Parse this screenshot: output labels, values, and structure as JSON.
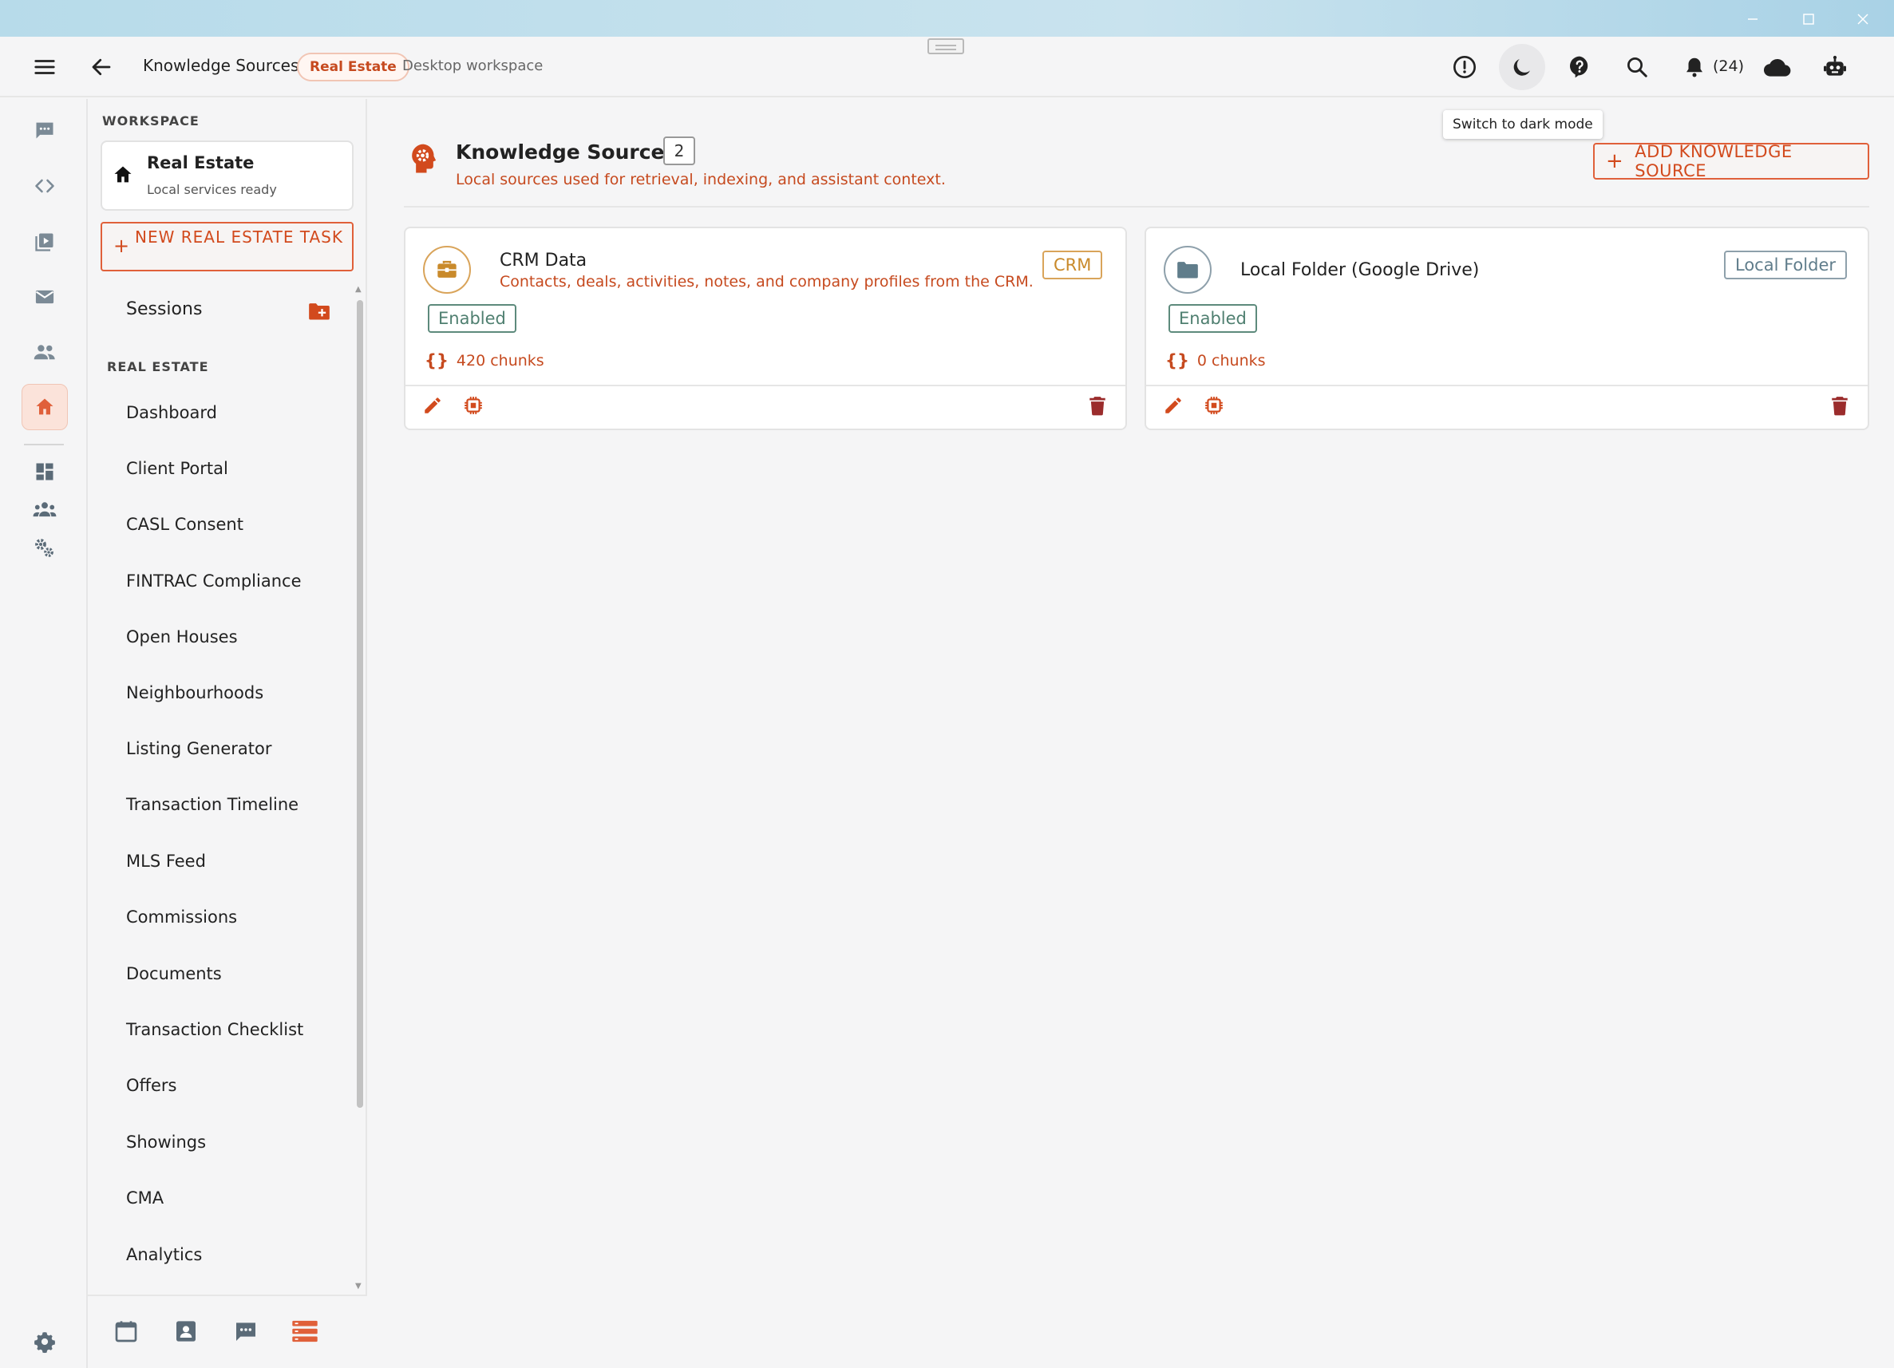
{
  "app": {
    "breadcrumb_title": "Knowledge Sources",
    "breadcrumb_pill": "Real Estate",
    "breadcrumb_sub": "Desktop workspace",
    "notification_count": "(24)",
    "tooltip": "Switch to dark mode"
  },
  "colors": {
    "accent": "#d24a1d",
    "accent_soft": "#fbe3da",
    "enabled_green": "#4f7f70",
    "crm_gold": "#c98a2b",
    "folder_slate": "#607d8b",
    "delete_red": "#9b2c2c"
  },
  "top_icons": [
    "menu-icon",
    "back-arrow-icon",
    "alert-circle-icon",
    "moon-icon",
    "help-icon",
    "search-icon",
    "bell-icon",
    "cloud-icon",
    "robot-icon"
  ],
  "rail": {
    "items": [
      "chat-icon",
      "code-icon",
      "media-icon",
      "mail-icon",
      "people-icon",
      "home-icon",
      "dashboard-icon",
      "groups-icon",
      "admin-settings-icon",
      "settings-icon"
    ],
    "active": "home-icon"
  },
  "sidebar": {
    "workspace_label": "WORKSPACE",
    "workspace_name": "Real Estate",
    "workspace_status": "Local services ready",
    "new_task_label": "NEW REAL ESTATE TASK",
    "sessions_label": "Sessions",
    "section_label": "REAL ESTATE",
    "nav_items": [
      "Dashboard",
      "Client Portal",
      "CASL Consent",
      "FINTRAC Compliance",
      "Open Houses",
      "Neighbourhoods",
      "Listing Generator",
      "Transaction Timeline",
      "MLS Feed",
      "Commissions",
      "Documents",
      "Transaction Checklist",
      "Offers",
      "Showings",
      "CMA",
      "Analytics"
    ],
    "bottom_icons": [
      "calendar-icon",
      "contacts-icon",
      "messages-icon",
      "list-view-icon"
    ]
  },
  "main": {
    "title": "Knowledge Sources",
    "count": "2",
    "subtitle": "Local sources used for retrieval, indexing, and assistant context.",
    "add_button": "ADD KNOWLEDGE SOURCE",
    "cards": [
      {
        "title": "CRM Data",
        "description": "Contacts, deals, activities, notes, and company profiles from the CRM.",
        "tag": "CRM",
        "status": "Enabled",
        "chunks": "420 chunks",
        "icon": "briefcase-icon"
      },
      {
        "title": "Local Folder (Google Drive)",
        "description": "",
        "tag": "Local Folder",
        "status": "Enabled",
        "chunks": "0 chunks",
        "icon": "folder-icon"
      }
    ]
  }
}
